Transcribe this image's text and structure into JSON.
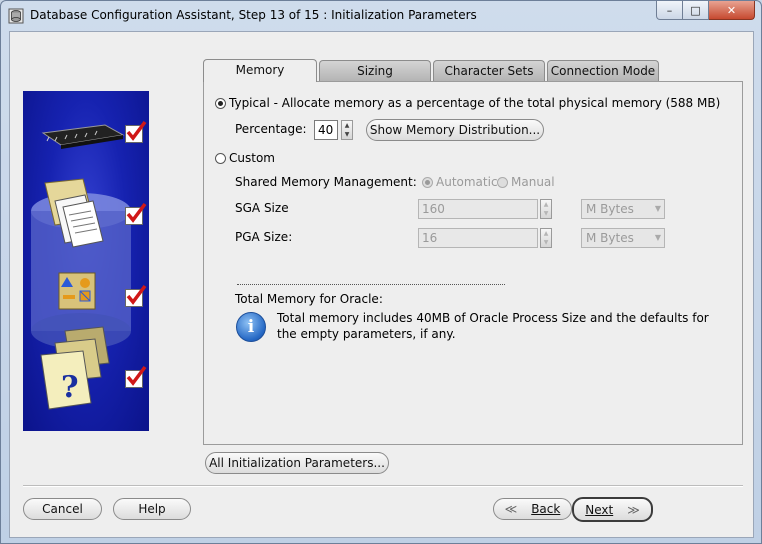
{
  "window": {
    "title": "Database Configuration Assistant, Step 13 of 15 : Initialization Parameters",
    "controls": {
      "minimize": "–",
      "maximize": "□",
      "close": "✕"
    }
  },
  "tabs": [
    {
      "label": "Memory",
      "active": true
    },
    {
      "label": "Sizing",
      "active": false
    },
    {
      "label": "Character Sets",
      "active": false
    },
    {
      "label": "Connection Mode",
      "active": false
    }
  ],
  "memory": {
    "typical_label": "Typical - Allocate memory as a percentage of the total physical memory (588 MB)",
    "typical_selected": true,
    "percentage_label": "Percentage:",
    "percentage_value": "40",
    "show_distribution_button": "Show Memory Distribution...",
    "custom_label": "Custom",
    "shared_memory_label": "Shared Memory Management:",
    "automatic_label": "Automatic",
    "manual_label": "Manual",
    "sga_label": "SGA Size",
    "sga_value": "160",
    "sga_unit": "M Bytes",
    "pga_label": "PGA Size:",
    "pga_value": "16",
    "pga_unit": "M Bytes",
    "total_label": "Total Memory for Oracle:",
    "info_text": "Total memory includes 40MB of Oracle Process Size and the defaults for the empty parameters, if any.",
    "info_glyph": "i"
  },
  "buttons": {
    "all_params": "All Initialization Parameters...",
    "cancel": "Cancel",
    "help": "Help",
    "back": "Back",
    "next": "Next",
    "back_glyph": "≪",
    "next_glyph": "≫"
  },
  "icons": {
    "app": "database-assistant-icon",
    "steps": [
      "chip-icon",
      "folder-database-icon",
      "shapes-icon",
      "help-folder-icon"
    ]
  },
  "colors": {
    "side_panel": "#1622b0",
    "check": "#d01818"
  }
}
